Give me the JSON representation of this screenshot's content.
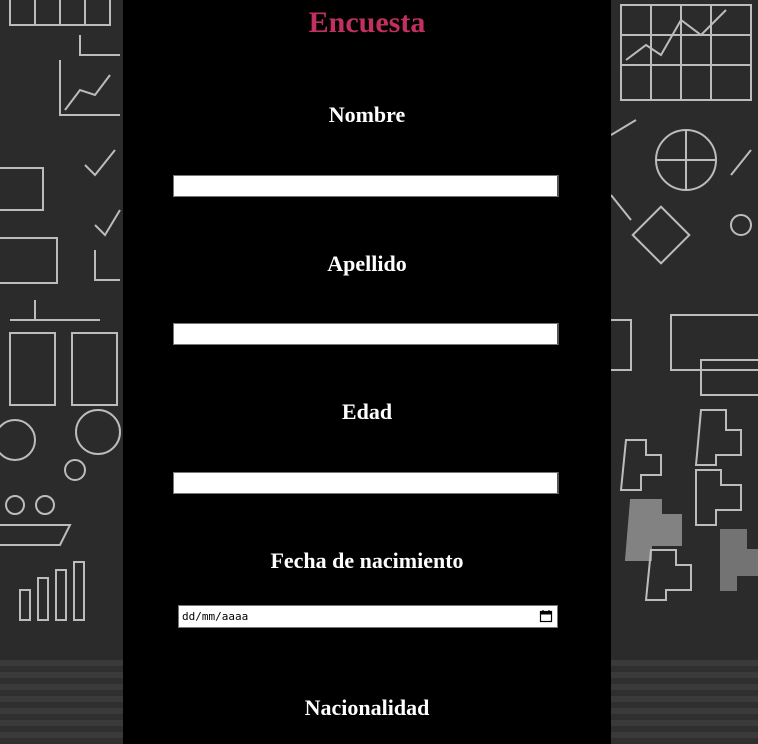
{
  "form": {
    "title": "Encuesta",
    "fields": [
      {
        "label": "Nombre",
        "value": ""
      },
      {
        "label": "Apellido",
        "value": ""
      },
      {
        "label": "Edad",
        "value": ""
      },
      {
        "label": "Fecha de nacimiento",
        "placeholder": "dd/mm/aaaa"
      },
      {
        "label": "Nacionalidad"
      }
    ]
  },
  "colors": {
    "title": "#c2305f",
    "panel": "#000000",
    "label": "#ffffff",
    "chalkboard": "#2b2b2b"
  }
}
